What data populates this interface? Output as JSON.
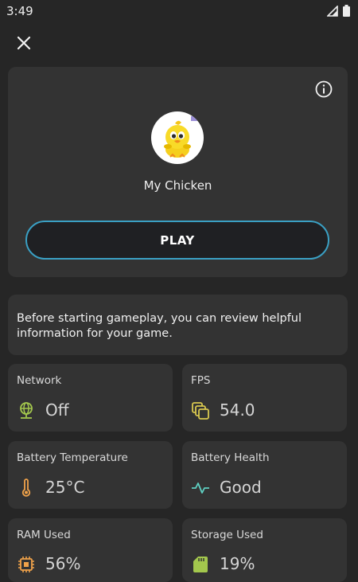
{
  "status_bar": {
    "time": "3:49"
  },
  "game": {
    "name": "My Chicken",
    "play_label": "PLAY"
  },
  "hint": "Before starting gameplay, you can review helpful information for your game.",
  "stats": {
    "network": {
      "label": "Network",
      "value": "Off",
      "icon": "globe-icon",
      "color": "#a3c74d"
    },
    "fps": {
      "label": "FPS",
      "value": "54.0",
      "icon": "layers-icon",
      "color": "#d9c84f"
    },
    "battery_temperature": {
      "label": "Battery Temperature",
      "value": "25°C",
      "icon": "thermometer-icon",
      "color": "#f0a24a"
    },
    "battery_health": {
      "label": "Battery Health",
      "value": "Good",
      "icon": "pulse-icon",
      "color": "#5fd0c2"
    },
    "ram_used": {
      "label": "RAM Used",
      "value": "56%",
      "icon": "chip-icon",
      "color": "#f0a24a"
    },
    "storage_used": {
      "label": "Storage Used",
      "value": "19%",
      "icon": "sd-card-icon",
      "color": "#a3c74d"
    }
  }
}
